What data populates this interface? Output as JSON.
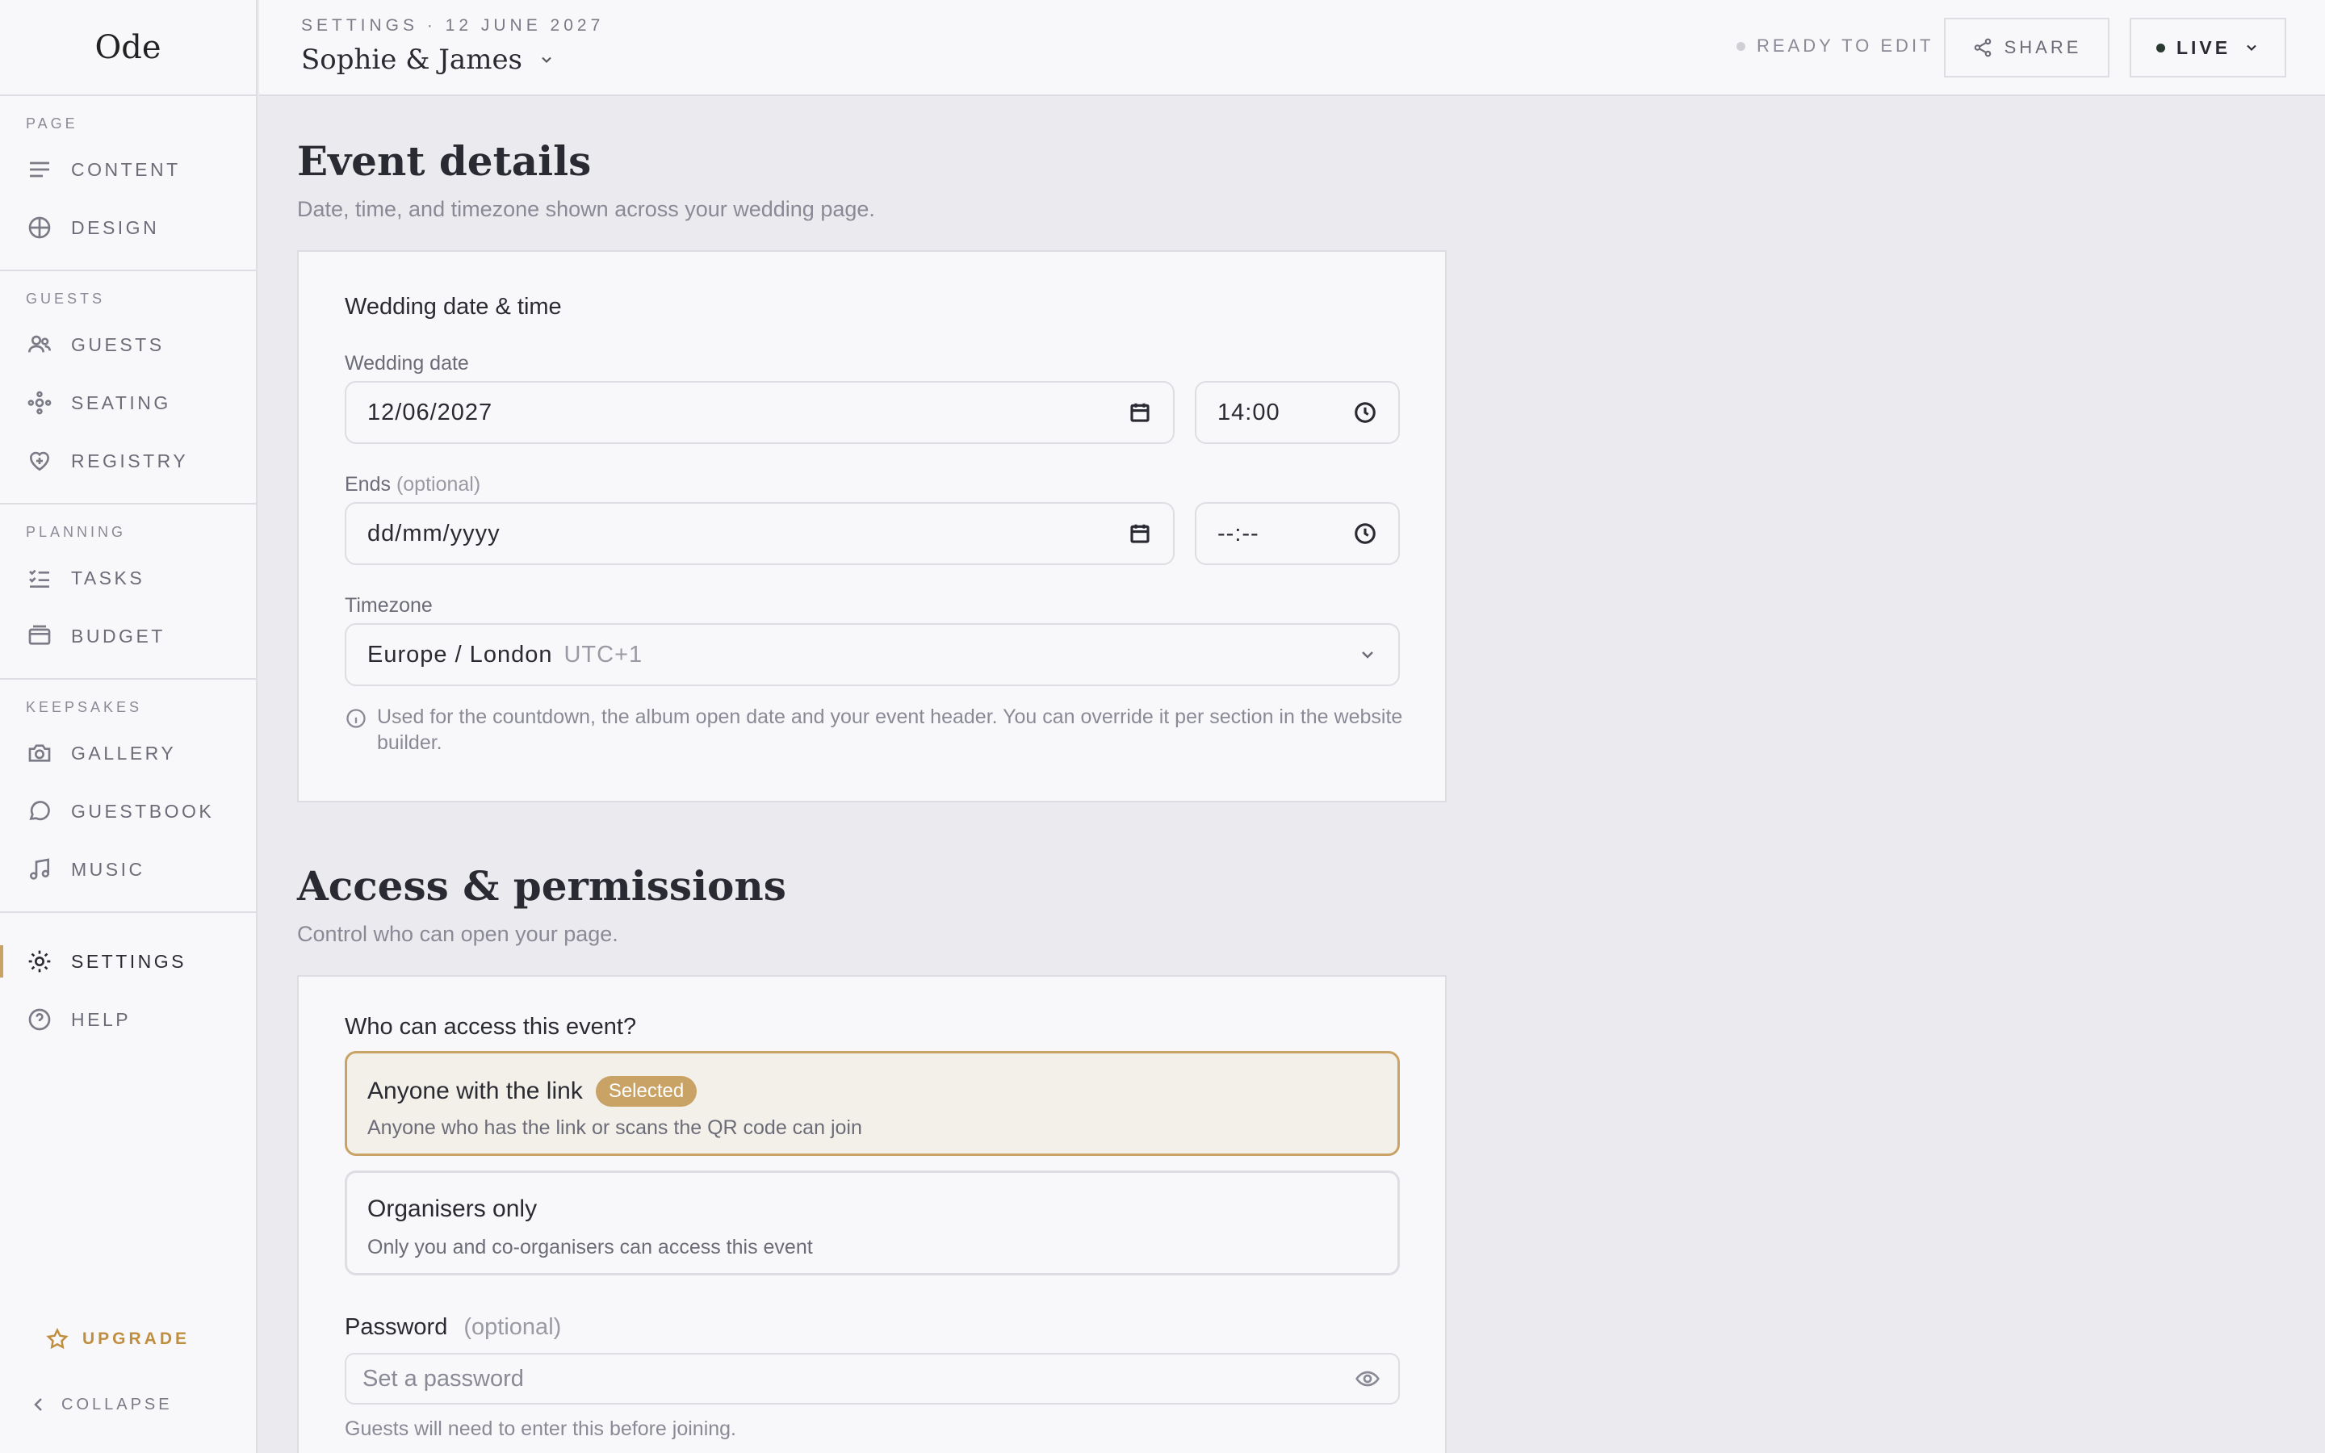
{
  "app": {
    "logo": "Ode"
  },
  "sidebar": {
    "sections": [
      {
        "heading": "PAGE",
        "items": [
          {
            "label": "CONTENT",
            "icon": "lines-icon"
          },
          {
            "label": "DESIGN",
            "icon": "globe-icon"
          }
        ]
      },
      {
        "heading": "GUESTS",
        "items": [
          {
            "label": "GUESTS",
            "icon": "users-icon"
          },
          {
            "label": "SEATING",
            "icon": "seating-icon"
          },
          {
            "label": "REGISTRY",
            "icon": "heart-plus-icon"
          }
        ]
      },
      {
        "heading": "PLANNING",
        "items": [
          {
            "label": "TASKS",
            "icon": "checklist-icon"
          },
          {
            "label": "BUDGET",
            "icon": "wallet-icon"
          }
        ]
      },
      {
        "heading": "KEEPSAKES",
        "items": [
          {
            "label": "GALLERY",
            "icon": "camera-icon"
          },
          {
            "label": "GUESTBOOK",
            "icon": "chat-icon"
          },
          {
            "label": "MUSIC",
            "icon": "music-icon"
          }
        ]
      },
      {
        "heading": "",
        "items": [
          {
            "label": "SETTINGS",
            "icon": "sun-gear-icon",
            "active": true
          },
          {
            "label": "HELP",
            "icon": "help-icon"
          }
        ]
      }
    ],
    "upgrade_label": "UPGRADE",
    "collapse_label": "COLLAPSE",
    "accent_color": "#c9a266"
  },
  "header": {
    "breadcrumb": "SETTINGS · 12 JUNE 2027",
    "event_name": "Sophie & James",
    "status": "READY TO EDIT",
    "share_label": "SHARE",
    "live_label": "LIVE"
  },
  "event_details": {
    "title": "Event details",
    "subtitle": "Date, time, and timezone shown across your wedding page.",
    "card_title": "Wedding date & time",
    "date_label": "Wedding date",
    "date_value": "12/06/2027",
    "time_value": "14:00",
    "ends_label": "Ends",
    "ends_optional": "(optional)",
    "ends_date_placeholder": "dd/mm/yyyy",
    "ends_time_placeholder": "--:--",
    "timezone_label": "Timezone",
    "timezone_value": "Europe / London",
    "timezone_offset": "UTC+1",
    "timezone_hint": "Used for the countdown, the album open date and your event header. You can override it per section in the website builder."
  },
  "access": {
    "title": "Access & permissions",
    "subtitle": "Control who can open your page.",
    "question": "Who can access this event?",
    "options": [
      {
        "title": "Anyone with the link",
        "badge": "Selected",
        "desc": "Anyone who has the link or scans the QR code can join",
        "selected": true
      },
      {
        "title": "Organisers only",
        "desc": "Only you and co-organisers can access this event",
        "selected": false
      }
    ],
    "password_label": "Password",
    "password_optional": "(optional)",
    "password_placeholder": "Set a password",
    "password_hint": "Guests will need to enter this before joining."
  }
}
